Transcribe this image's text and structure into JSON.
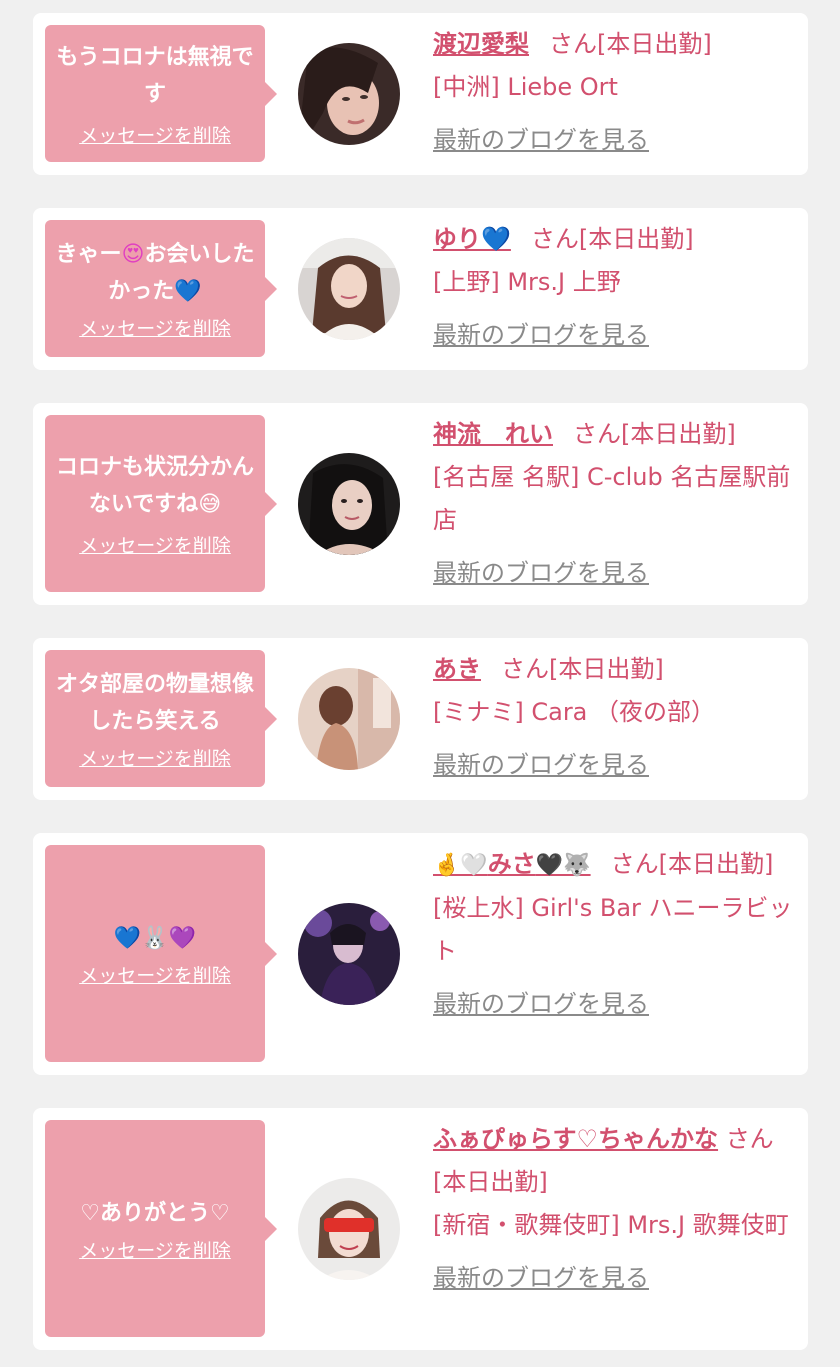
{
  "delete_label": "メッセージを削除",
  "blog_label": "最新のブログを見る",
  "suffix": "さん[本日出勤]",
  "colors": {
    "background": "#f0f0f0",
    "card": "#ffffff",
    "bubble": "#eda0ac",
    "accent_text": "#d2506e",
    "blog_link": "#8a8a8a"
  },
  "messages": [
    {
      "message": "もうコロナは無視です",
      "name": "渡辺愛梨",
      "shop": "[中洲] Liebe Ort",
      "avatar": "photo-woman-dark-hair"
    },
    {
      "message_before": "きゃー",
      "message_emoji1": "😍",
      "message_mid": "お会いしたかった",
      "message_emoji2": "💙",
      "name": "ゆり",
      "name_emoji": "💙",
      "shop": "[上野] Mrs.J 上野",
      "avatar": "photo-woman-light-top"
    },
    {
      "message": "コロナも状況分かんないですね",
      "message_emoji": "😅",
      "name": "神流　れい",
      "shop": "[名古屋 名駅] C-club 名古屋駅前店",
      "avatar": "photo-woman-dark-background"
    },
    {
      "message": "オタ部屋の物量想像したら笑える",
      "name": "あき",
      "shop": "[ミナミ] Cara （夜の部）",
      "avatar": "photo-woman-back-view"
    },
    {
      "message": "💙🐰💜",
      "name_prefix": "🤞🤍",
      "name": "みさ",
      "name_suffix": "🖤🐺",
      "shop": "[桜上水] Girl's Bar ハニーラビット",
      "avatar": "photo-woman-purple-light"
    },
    {
      "message": "♡ありがとう♡",
      "name": "ふぁぴゅらす♡ちゃんかな",
      "shop": "[新宿・歌舞伎町] Mrs.J 歌舞伎町",
      "avatar": "photo-woman-red-glasses"
    }
  ]
}
